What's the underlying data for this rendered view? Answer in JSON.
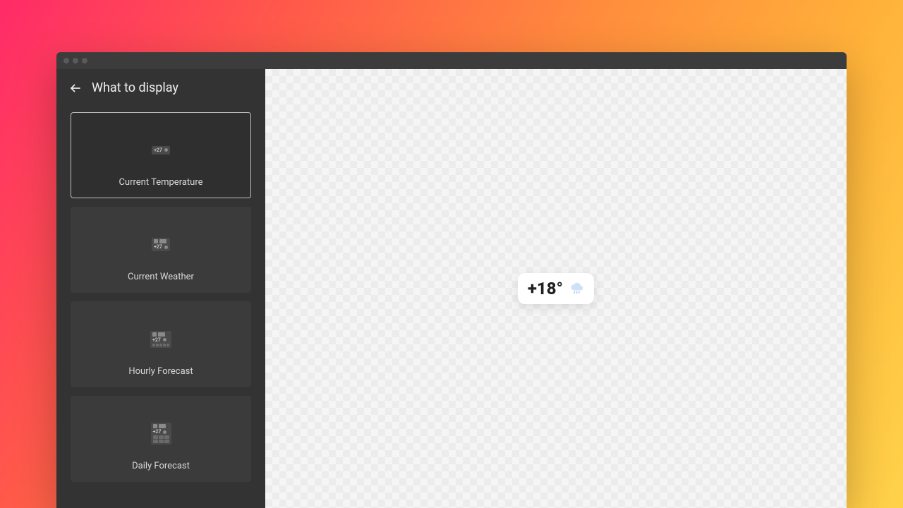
{
  "sidebar": {
    "title": "What to display",
    "options": [
      {
        "label": "Current Temperature",
        "preview_temp": "+27"
      },
      {
        "label": "Current Weather",
        "preview_temp": "+27"
      },
      {
        "label": "Hourly Forecast",
        "preview_temp": "+27"
      },
      {
        "label": "Daily Forecast",
        "preview_temp": "+27"
      }
    ]
  },
  "canvas": {
    "widget_temperature": "+18°"
  },
  "colors": {
    "cloud": "#cfe0f7"
  }
}
